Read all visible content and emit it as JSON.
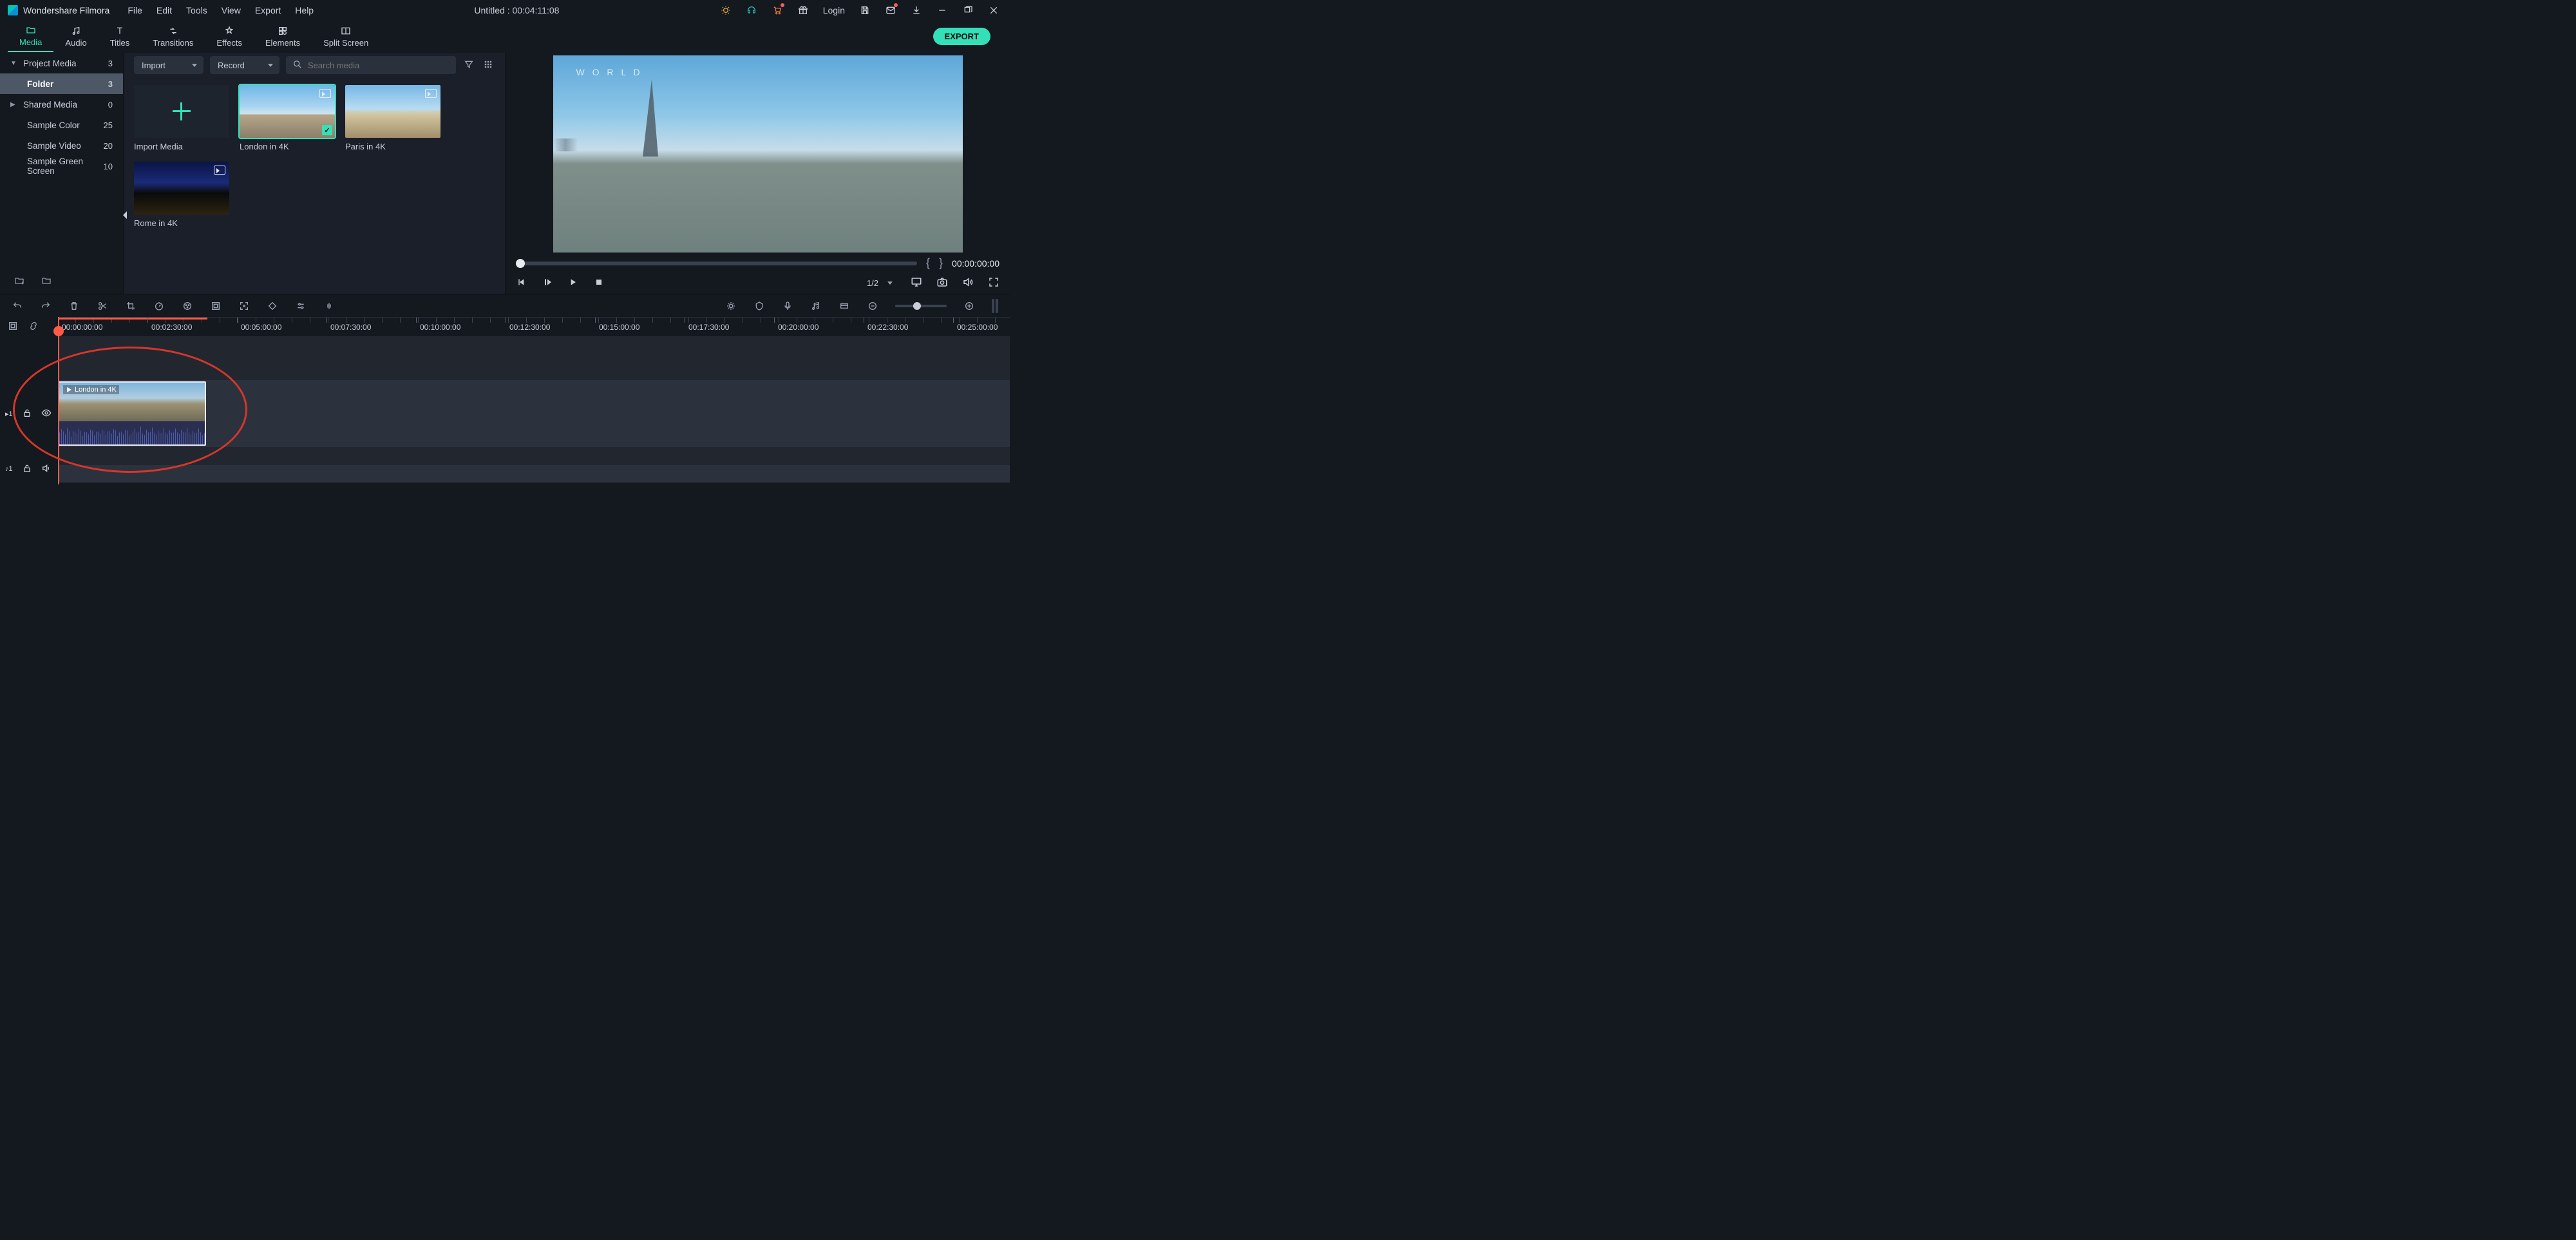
{
  "app_name": "Wondershare Filmora",
  "menus": [
    "File",
    "Edit",
    "Tools",
    "View",
    "Export",
    "Help"
  ],
  "title": "Untitled : 00:04:11:08",
  "login_label": "Login",
  "export_button": "EXPORT",
  "tabs": [
    {
      "label": "Media",
      "active": true
    },
    {
      "label": "Audio"
    },
    {
      "label": "Titles"
    },
    {
      "label": "Transitions"
    },
    {
      "label": "Effects"
    },
    {
      "label": "Elements"
    },
    {
      "label": "Split Screen"
    }
  ],
  "sidebar": {
    "items": [
      {
        "label": "Project Media",
        "count": "3",
        "expandable": true,
        "expanded": true
      },
      {
        "label": "Folder",
        "count": "3",
        "selected": true,
        "indent": true
      },
      {
        "label": "Shared Media",
        "count": "0",
        "expandable": true,
        "expanded": false
      },
      {
        "label": "Sample Color",
        "count": "25"
      },
      {
        "label": "Sample Video",
        "count": "20"
      },
      {
        "label": "Sample Green Screen",
        "count": "10"
      }
    ]
  },
  "media_toolbar": {
    "import_label": "Import",
    "record_label": "Record",
    "search_placeholder": "Search media"
  },
  "media_items": [
    {
      "label": "Import Media",
      "type": "add"
    },
    {
      "label": "London in 4K",
      "selected": true,
      "checked": true
    },
    {
      "label": "Paris in 4K"
    },
    {
      "label": "Rome in 4K"
    }
  ],
  "preview": {
    "watermark": "W O R L D",
    "timecode": "00:00:00:00",
    "ratio": "1/2"
  },
  "ruler": {
    "labels": [
      "00:00:00:00",
      "00:02:30:00",
      "00:05:00:00",
      "00:07:30:00",
      "00:10:00:00",
      "00:12:30:00",
      "00:15:00:00",
      "00:17:30:00",
      "00:20:00:00",
      "00:22:30:00",
      "00:25:00:00"
    ]
  },
  "timeline": {
    "video_track_id": "1",
    "audio_track_id": "1",
    "clip_label": "London in 4K"
  }
}
